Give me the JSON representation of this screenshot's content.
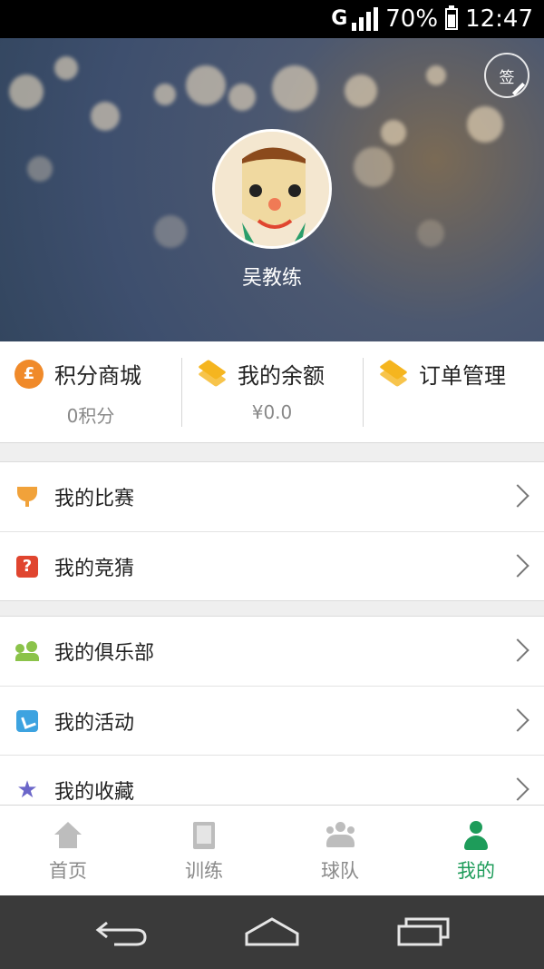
{
  "status_bar": {
    "signal": "G",
    "battery": "70%",
    "time": "12:47"
  },
  "header": {
    "sign_label": "签",
    "username": "吴教练"
  },
  "stats": [
    {
      "title": "积分商城",
      "value": "0积分"
    },
    {
      "title": "我的余额",
      "value": "¥0.0"
    },
    {
      "title": "订单管理",
      "value": ""
    }
  ],
  "menu": {
    "group1": [
      {
        "label": "我的比赛",
        "icon": "trophy-icon"
      },
      {
        "label": "我的竞猜",
        "icon": "question-icon"
      }
    ],
    "group2": [
      {
        "label": "我的俱乐部",
        "icon": "people-icon"
      },
      {
        "label": "我的活动",
        "icon": "flag-icon"
      },
      {
        "label": "我的收藏",
        "icon": "star-icon"
      }
    ]
  },
  "tabs": [
    {
      "label": "首页",
      "icon": "home-icon"
    },
    {
      "label": "训练",
      "icon": "book-icon"
    },
    {
      "label": "球队",
      "icon": "team-icon"
    },
    {
      "label": "我的",
      "icon": "person-icon",
      "active": true
    }
  ],
  "colors": {
    "accent": "#1e9c5a",
    "coin": "#f08a2a",
    "layers": "#f5b51f"
  }
}
